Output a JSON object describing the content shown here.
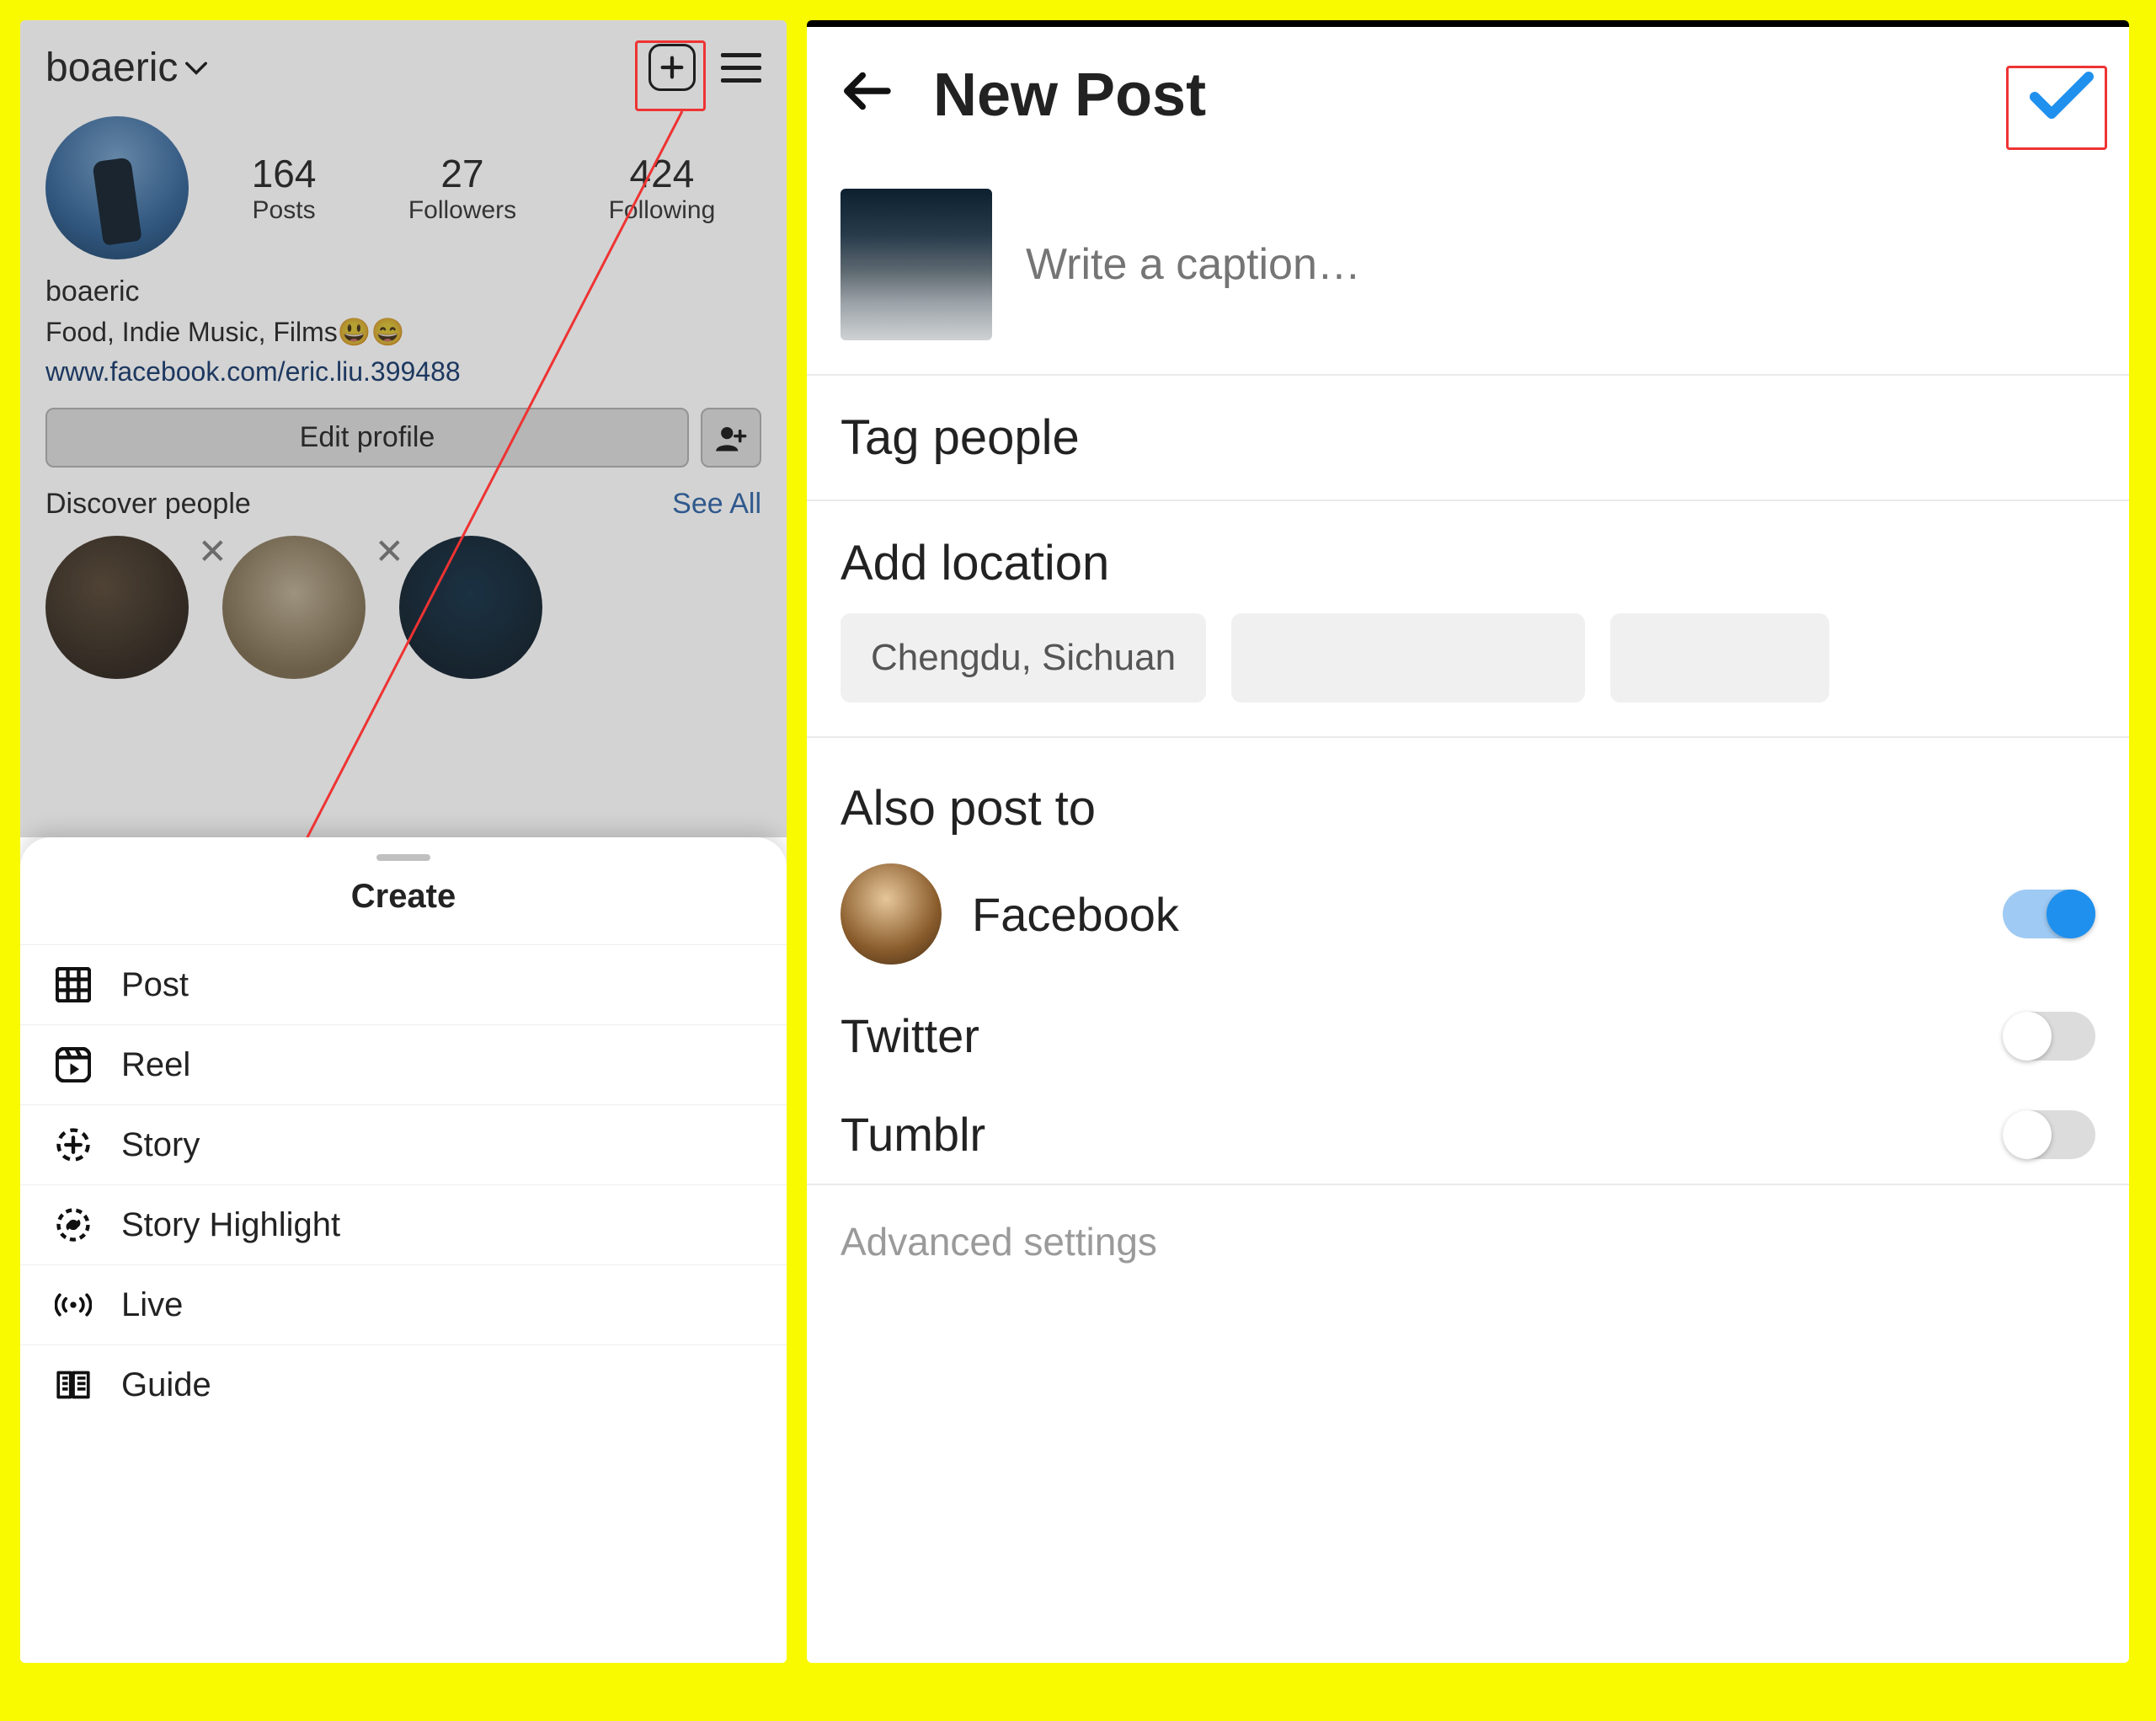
{
  "left": {
    "username": "boaeric",
    "stats": {
      "posts": {
        "value": "164",
        "label": "Posts"
      },
      "followers": {
        "value": "27",
        "label": "Followers"
      },
      "following": {
        "value": "424",
        "label": "Following"
      }
    },
    "bio": {
      "display_name": "boaeric",
      "line": "Food, Indie Music, Films😃😄",
      "link": "www.facebook.com/eric.liu.399488"
    },
    "edit_profile": "Edit profile",
    "discover": {
      "title": "Discover people",
      "see_all": "See All"
    },
    "sheet_title": "Create",
    "sheet_items": {
      "post": "Post",
      "reel": "Reel",
      "story": "Story",
      "highlight": "Story Highlight",
      "live": "Live",
      "guide": "Guide"
    }
  },
  "right": {
    "title": "New Post",
    "caption_placeholder": "Write a caption…",
    "tag_people": "Tag people",
    "add_location": "Add location",
    "location_suggestion": "Chengdu, Sichuan",
    "also_post_to": "Also post to",
    "share": {
      "facebook": {
        "label": "Facebook",
        "on": true
      },
      "twitter": {
        "label": "Twitter",
        "on": false
      },
      "tumblr": {
        "label": "Tumblr",
        "on": false
      }
    },
    "advanced": "Advanced settings"
  }
}
